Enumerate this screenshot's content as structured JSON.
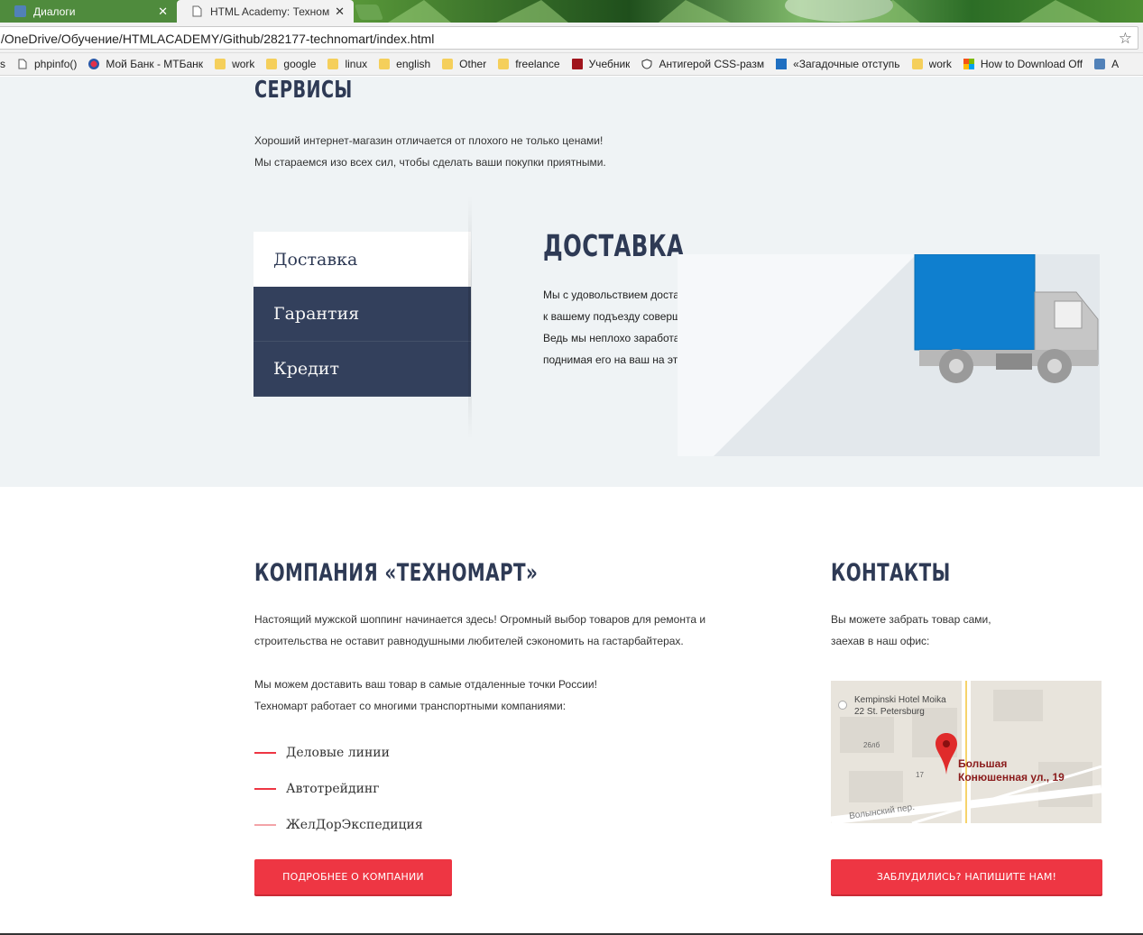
{
  "browser": {
    "tabs": [
      {
        "title": "Диалоги",
        "active": false
      },
      {
        "title": "HTML Academy: Техном",
        "active": true
      }
    ],
    "url": "/OneDrive/Обучение/HTMLACADEMY/Github/282177-technomart/index.html",
    "bookmarks": [
      {
        "label": "s",
        "icon": "none"
      },
      {
        "label": "phpinfo()",
        "icon": "page-icon"
      },
      {
        "label": "Мой Банк - МТБанк",
        "icon": "bank-icon"
      },
      {
        "label": "work",
        "icon": "folder-icon"
      },
      {
        "label": "google",
        "icon": "folder-icon"
      },
      {
        "label": "linux",
        "icon": "folder-icon"
      },
      {
        "label": "english",
        "icon": "folder-icon"
      },
      {
        "label": "Other",
        "icon": "folder-icon"
      },
      {
        "label": "freelance",
        "icon": "folder-icon"
      },
      {
        "label": "Учебник",
        "icon": "book-icon"
      },
      {
        "label": "Антигерой CSS-разм",
        "icon": "shield-icon"
      },
      {
        "label": "«Загадочные отступь",
        "icon": "css-icon"
      },
      {
        "label": "work",
        "icon": "folder-icon"
      },
      {
        "label": "How to Download Off",
        "icon": "windows-icon"
      },
      {
        "label": "A",
        "icon": "vk-icon"
      }
    ]
  },
  "services": {
    "title": "СЕРВИСЫ",
    "text_line1": "Хороший интернет-магазин отличается от плохого не только ценами!",
    "text_line2": "Мы стараемся изо всех сил, чтобы сделать ваши покупки приятными.",
    "tabs": [
      "Доставка",
      "Гарантия",
      "Кредит"
    ],
    "delivery": {
      "title": "ДОСТАВКА",
      "lines": [
        "Мы с удовольствием доставим ваш товар прямо",
        "к вашему подъезду совершенно бесплатно!",
        "Ведь мы неплохо заработаем,",
        "поднимая его на ваш на этаж!"
      ]
    }
  },
  "company": {
    "title": "КОМПАНИЯ «ТЕХНОМАРТ»",
    "text_line1": "Настоящий мужской шоппинг начинается здесь! Огромный выбор товаров для ремонта и",
    "text_line2": "строительства не оставит равнодушными любителей сэкономить на гастарбайтерах.",
    "text2_line1": "Мы можем доставить ваш товар в самые отдаленные точки России!",
    "text2_line2": "Техномарт работает со многими транспортными компаниями:",
    "partners": [
      "Деловые линии",
      "Автотрейдинг",
      "ЖелДорЭкспедиция"
    ],
    "button": "ПОДРОБНЕЕ О КОМПАНИИ"
  },
  "contacts": {
    "title": "КОНТАКТЫ",
    "text_line1": "Вы можете забрать товар сами,",
    "text_line2": "заехав в наш офис:",
    "map": {
      "hotel_line1": "Kempinski Hotel Moika",
      "hotel_line2": "22 St. Petersburg",
      "address_line1": "Большая",
      "address_line2": "Конюшенная ул., 19",
      "street": "Волынский пер.",
      "label_26b": "26лб",
      "label_17": "17"
    },
    "button": "ЗАБЛУДИЛИСЬ? НАПИШИТЕ НАМ!"
  },
  "colors": {
    "accent": "#ee3643",
    "navy": "#33405c",
    "services_bg": "#eff3f5",
    "truck_blue": "#0f7fcf"
  }
}
